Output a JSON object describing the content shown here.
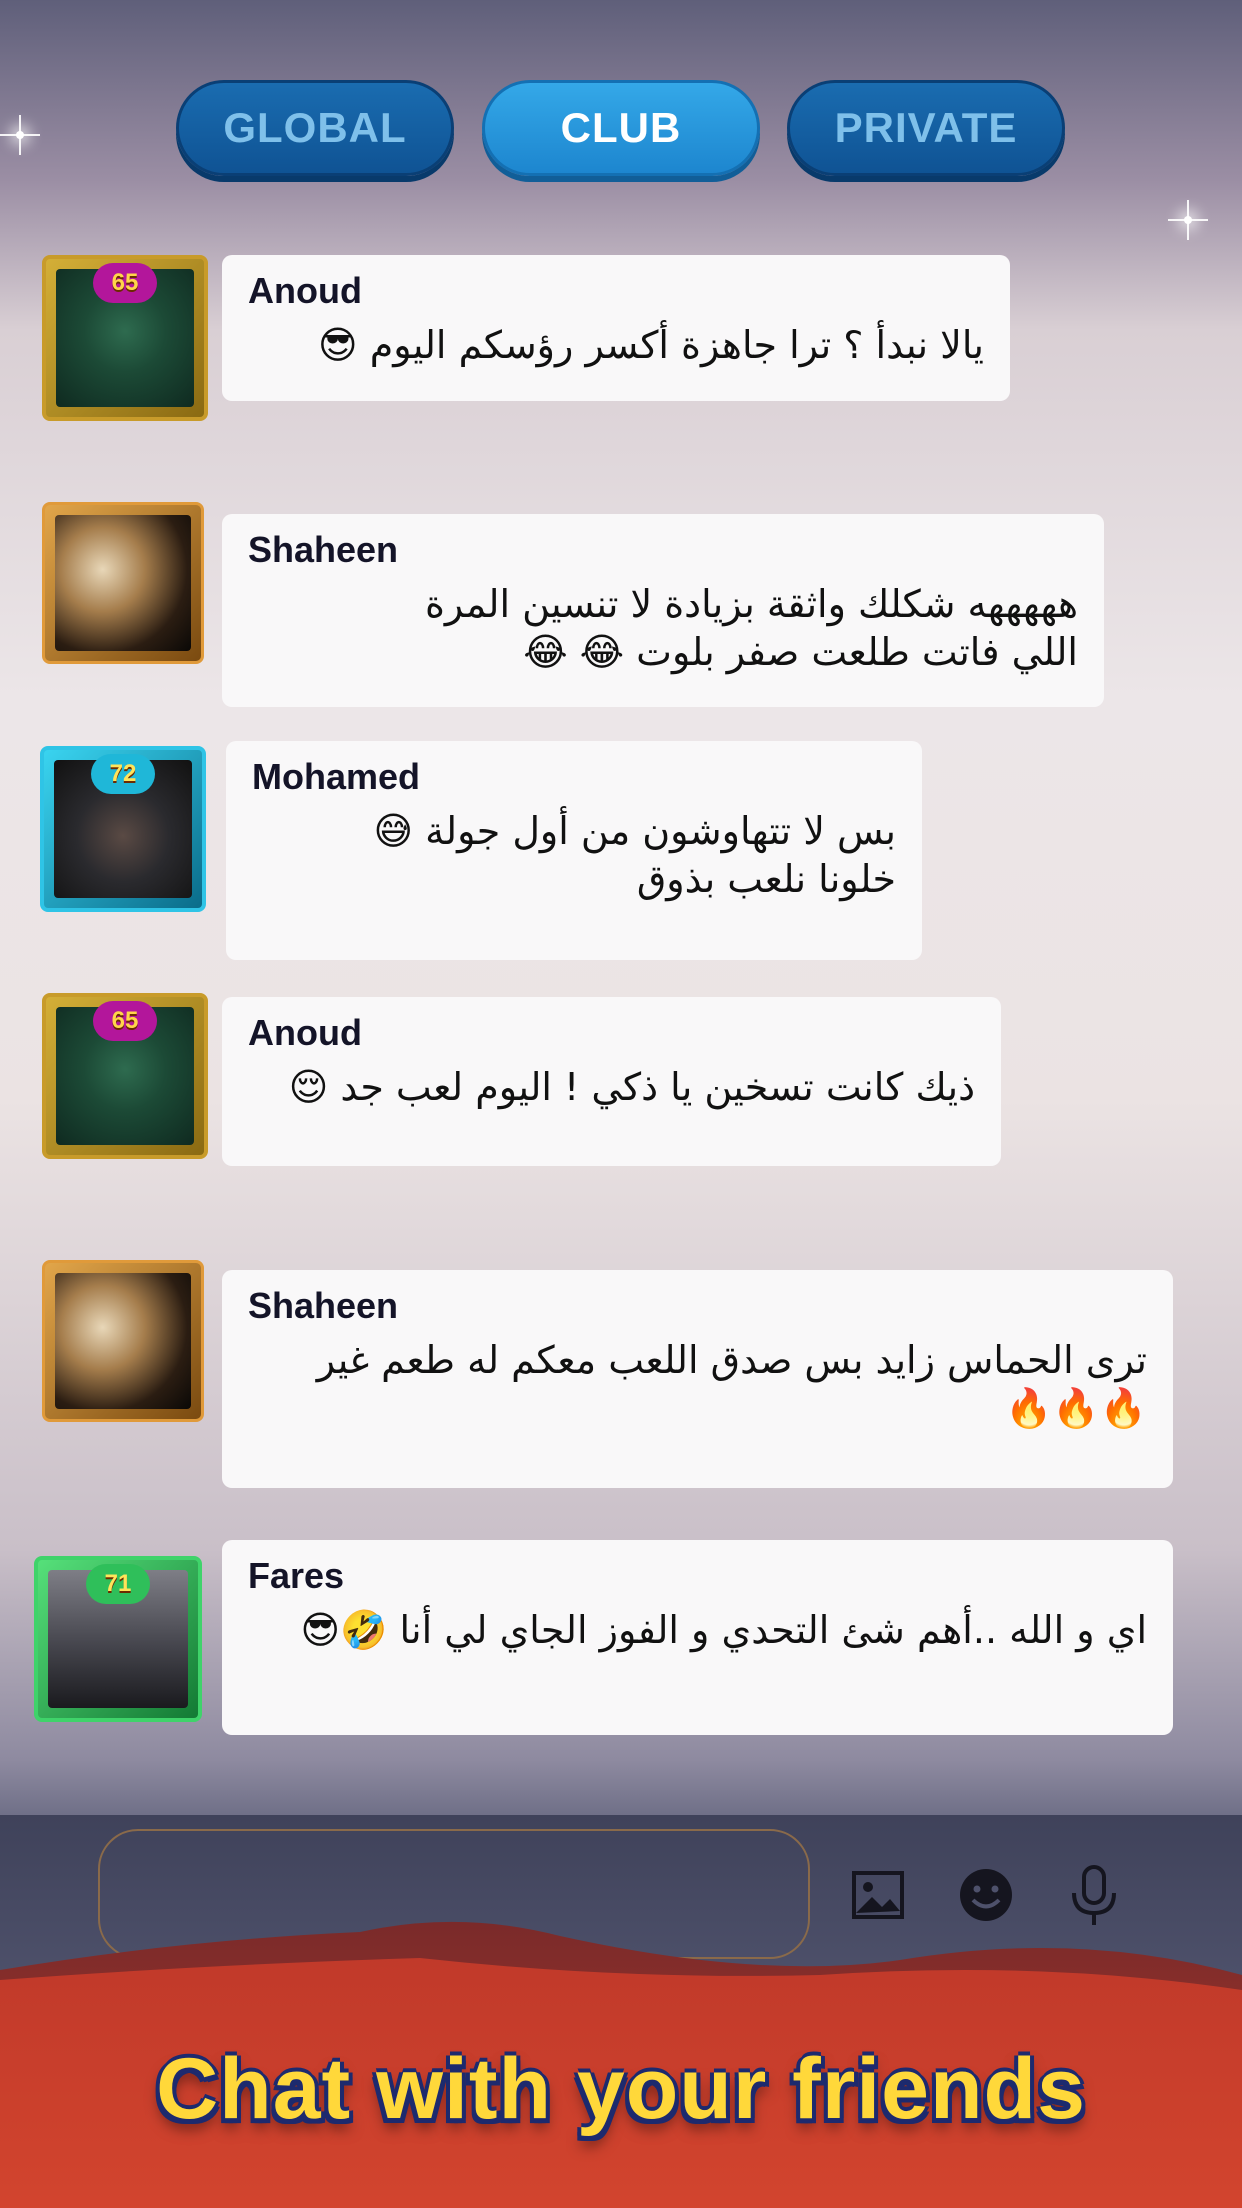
{
  "tabs": [
    {
      "label": "GLOBAL",
      "active": false
    },
    {
      "label": "CLUB",
      "active": true
    },
    {
      "label": "PRIVATE",
      "active": false
    }
  ],
  "messages": [
    {
      "name": "Anoud",
      "level": "65",
      "text": "يالا نبدأ ؟ ترا جاهزة أكسر رؤسكم اليوم 😎"
    },
    {
      "name": "Shaheen",
      "level": "",
      "text": "هههههه شكلك واثقة بزيادة لا تنسين المرة\nاللي فاتت طلعت صفر بلوت 😂 😂"
    },
    {
      "name": "Mohamed",
      "level": "72",
      "text": "بس لا تتهاوشون من أول جولة 😅\nخلونا نلعب بذوق"
    },
    {
      "name": "Anoud",
      "level": "65",
      "text": "ذيك كانت تسخين يا ذكي ! اليوم لعب جد 😌"
    },
    {
      "name": "Shaheen",
      "level": "",
      "text": "ترى الحماس زايد بس صدق اللعب معكم له طعم غير\n🔥🔥🔥"
    },
    {
      "name": "Fares",
      "level": "71",
      "text": "اي و الله ..أهم شئ التحدي و الفوز الجاي لي أنا 🤣😎"
    }
  ],
  "input": {
    "placeholder": ""
  },
  "icons": {
    "image": "image-icon",
    "emoji": "emoji-icon",
    "mic": "microphone-icon"
  },
  "banner": {
    "headline": "Chat with your friends"
  },
  "colors": {
    "tab_active": "#1d86cf",
    "tab_inactive": "#0f5394",
    "banner": "#d4452e",
    "headline": "#ffd83a"
  }
}
